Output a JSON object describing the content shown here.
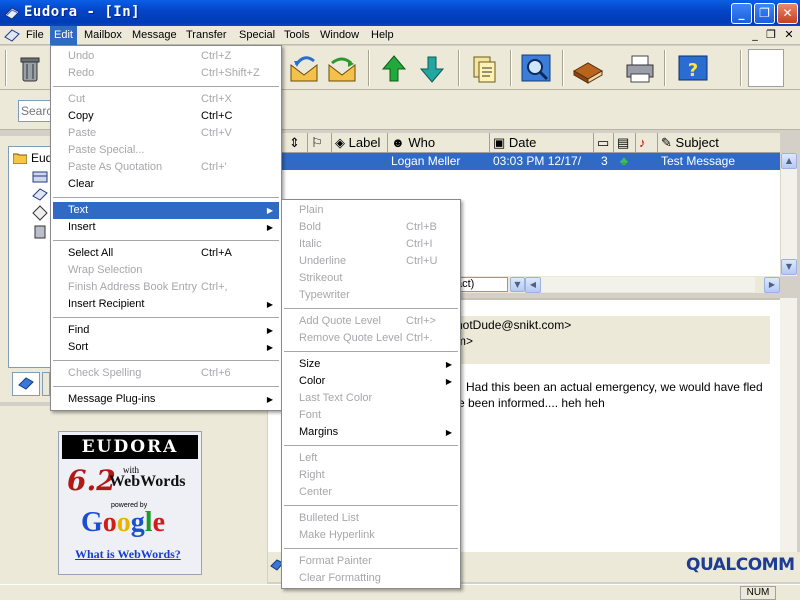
{
  "window": {
    "title": "Eudora - [In]"
  },
  "menubar": [
    "File",
    "Edit",
    "Mailbox",
    "Message",
    "Transfer",
    "Special",
    "Tools",
    "Window",
    "Help"
  ],
  "search": {
    "placeholder": "Search"
  },
  "tree": {
    "root": "Eudora"
  },
  "list": {
    "columns": [
      "Label",
      "Who",
      "Date",
      "Subject"
    ],
    "row": {
      "who": "Logan Meller",
      "date": "03:03 PM 12/17/",
      "size": "3",
      "subject": "Test Message"
    }
  },
  "dropdown_stub": "act)",
  "preview": {
    "lines": [
      "notDude@snikt.com>",
      "m>",
      "Had this been an actual emergency, we would have fled",
      "e been informed.... heh heh"
    ]
  },
  "ad": {
    "brand": "EUDORA",
    "version": "6.2",
    "with": "with",
    "product": "WebWords",
    "powered": "powered by",
    "google": "Google",
    "link": "What is WebWords?"
  },
  "branding": "QUALCOMM",
  "status": {
    "num": "NUM"
  },
  "edit_menu": {
    "items": [
      {
        "label": "Undo",
        "shortcut": "Ctrl+Z",
        "disabled": true
      },
      {
        "label": "Redo",
        "shortcut": "Ctrl+Shift+Z",
        "disabled": true
      },
      {
        "label": "Cut",
        "shortcut": "Ctrl+X",
        "disabled": true
      },
      {
        "label": "Copy",
        "shortcut": "Ctrl+C",
        "disabled": false
      },
      {
        "label": "Paste",
        "shortcut": "Ctrl+V",
        "disabled": true
      },
      {
        "label": "Paste Special...",
        "shortcut": "",
        "disabled": true
      },
      {
        "label": "Paste As Quotation",
        "shortcut": "Ctrl+'",
        "disabled": true
      },
      {
        "label": "Clear",
        "shortcut": "",
        "disabled": false
      },
      {
        "label": "Text",
        "shortcut": "",
        "disabled": false
      },
      {
        "label": "Insert",
        "shortcut": "",
        "disabled": false
      },
      {
        "label": "Select All",
        "shortcut": "Ctrl+A",
        "disabled": false
      },
      {
        "label": "Wrap Selection",
        "shortcut": "",
        "disabled": true
      },
      {
        "label": "Finish Address Book Entry",
        "shortcut": "Ctrl+,",
        "disabled": true
      },
      {
        "label": "Insert Recipient",
        "shortcut": "",
        "disabled": false
      },
      {
        "label": "Find",
        "shortcut": "",
        "disabled": false
      },
      {
        "label": "Sort",
        "shortcut": "",
        "disabled": false
      },
      {
        "label": "Check Spelling",
        "shortcut": "Ctrl+6",
        "disabled": true
      },
      {
        "label": "Message Plug-ins",
        "shortcut": "",
        "disabled": false
      }
    ]
  },
  "text_menu": {
    "items": [
      {
        "label": "Plain",
        "shortcut": "",
        "disabled": true
      },
      {
        "label": "Bold",
        "shortcut": "Ctrl+B",
        "disabled": true
      },
      {
        "label": "Italic",
        "shortcut": "Ctrl+I",
        "disabled": true
      },
      {
        "label": "Underline",
        "shortcut": "Ctrl+U",
        "disabled": true
      },
      {
        "label": "Strikeout",
        "shortcut": "",
        "disabled": true
      },
      {
        "label": "Typewriter",
        "shortcut": "",
        "disabled": true
      },
      {
        "label": "Add Quote Level",
        "shortcut": "Ctrl+>",
        "disabled": true
      },
      {
        "label": "Remove Quote Level",
        "shortcut": "Ctrl+.",
        "disabled": true
      },
      {
        "label": "Size",
        "shortcut": "",
        "disabled": false
      },
      {
        "label": "Color",
        "shortcut": "",
        "disabled": false
      },
      {
        "label": "Last Text Color",
        "shortcut": "",
        "disabled": true
      },
      {
        "label": "Font",
        "shortcut": "",
        "disabled": true
      },
      {
        "label": "Margins",
        "shortcut": "",
        "disabled": false
      },
      {
        "label": "Left",
        "shortcut": "",
        "disabled": true
      },
      {
        "label": "Right",
        "shortcut": "",
        "disabled": true
      },
      {
        "label": "Center",
        "shortcut": "",
        "disabled": true
      },
      {
        "label": "Bulleted List",
        "shortcut": "",
        "disabled": true
      },
      {
        "label": "Make Hyperlink",
        "shortcut": "",
        "disabled": true
      },
      {
        "label": "Format Painter",
        "shortcut": "",
        "disabled": true
      },
      {
        "label": "Clear Formatting",
        "shortcut": "",
        "disabled": true
      }
    ]
  },
  "colors": {
    "titlebar": "#0445c8",
    "selection": "#316ac5",
    "chrome": "#ece9d8",
    "disabled_text": "#a7a6aa"
  }
}
